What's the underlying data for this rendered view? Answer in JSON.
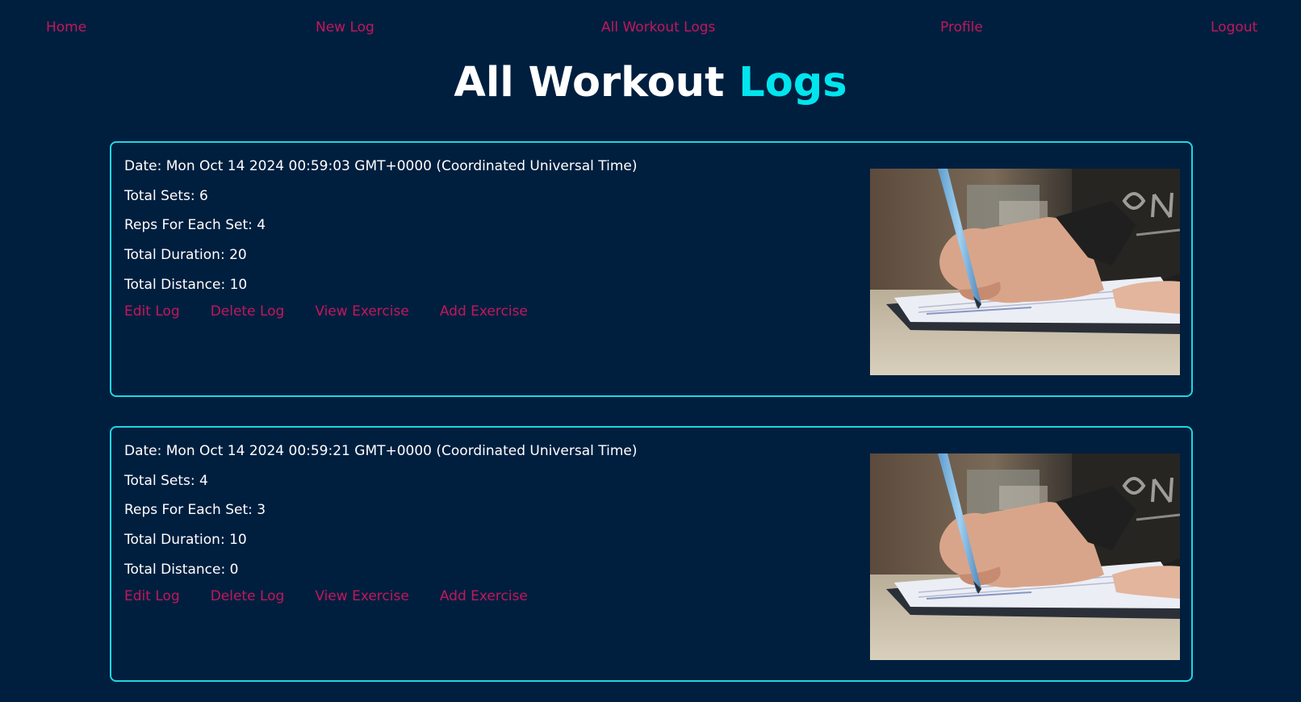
{
  "nav": {
    "home": "Home",
    "new_log": "New Log",
    "all_logs": "All Workout Logs",
    "profile": "Profile",
    "logout": "Logout"
  },
  "page": {
    "title_main": "All Workout",
    "title_accent": "Logs"
  },
  "logs": [
    {
      "date": "Date: Mon Oct 14 2024 00:59:03 GMT+0000 (Coordinated Universal Time)",
      "sets": "Total Sets: 6",
      "reps": "Reps For Each Set: 4",
      "duration": "Total Duration: 20",
      "distance": "Total Distance: 10",
      "edit": "Edit Log",
      "delete": "Delete Log",
      "view": "View Exercise",
      "add": "Add Exercise"
    },
    {
      "date": "Date: Mon Oct 14 2024 00:59:21 GMT+0000 (Coordinated Universal Time)",
      "sets": "Total Sets: 4",
      "reps": "Reps For Each Set: 3",
      "duration": "Total Duration: 10",
      "distance": "Total Distance: 0",
      "edit": "Edit Log",
      "delete": "Delete Log",
      "view": "View Exercise",
      "add": "Add Exercise"
    }
  ],
  "colors": {
    "background": "#001f3f",
    "link": "#c2185b",
    "accent": "#00e5ee",
    "card_border": "#1ed8e0"
  },
  "image": {
    "name": "hand-writing-in-notebook-photo"
  }
}
